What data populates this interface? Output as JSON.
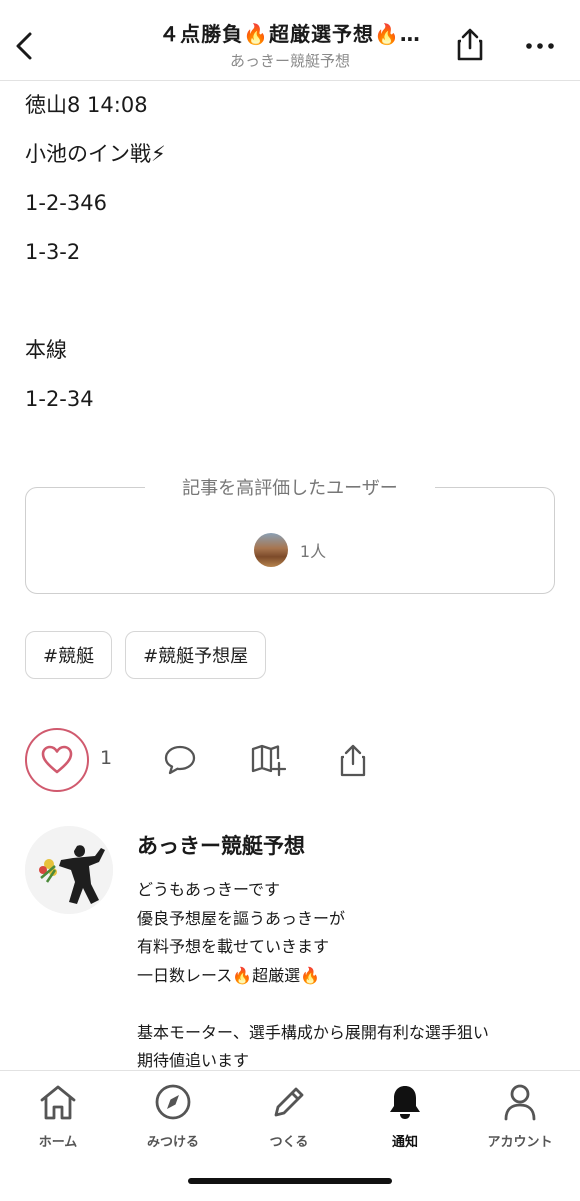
{
  "header": {
    "title": "４点勝負🔥超厳選予想🔥…",
    "subtitle": "あっきー競艇予想",
    "back_icon": "chevron-left-icon",
    "share_icon": "share-icon",
    "more_icon": "more-horizontal-icon"
  },
  "body_lines": [
    "徳山8 14:08",
    "小池のイン戦⚡",
    "1-2-346",
    "1-3-2",
    "",
    "本線",
    "1-2-34"
  ],
  "likers": {
    "title": "記事を高評価したユーザー",
    "count": "1人"
  },
  "tags": [
    "#競艇",
    "#競艇予想屋"
  ],
  "actions": {
    "like_count": "1",
    "accent": "#d05a6e"
  },
  "author": {
    "name": "あっきー競艇予想",
    "bio": [
      "どうもあっきーです",
      "優良予想屋を謳うあっきーが",
      "有料予想を載せていきます",
      "一日数レース🔥超厳選🔥",
      "",
      "基本モーター、選手構成から展開有利な選手狙い",
      "期待値追います"
    ]
  },
  "tabbar": {
    "tabs": [
      {
        "label": "ホーム",
        "icon": "home-icon"
      },
      {
        "label": "みつける",
        "icon": "compass-icon"
      },
      {
        "label": "つくる",
        "icon": "pencil-icon"
      },
      {
        "label": "通知",
        "icon": "bell-icon",
        "active": true
      },
      {
        "label": "アカウント",
        "icon": "user-icon"
      }
    ]
  }
}
